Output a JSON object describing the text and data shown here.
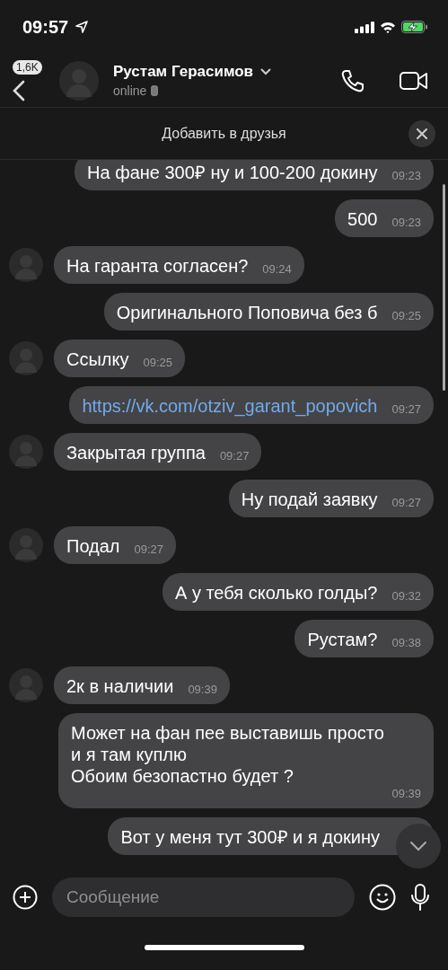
{
  "status_bar": {
    "time": "09:57"
  },
  "header": {
    "back_badge": "1,6K",
    "name": "Рустам Герасимов",
    "status": "online"
  },
  "banner": {
    "text": "Добавить в друзья"
  },
  "messages": [
    {
      "kind": "outgoing",
      "text": "На фане 300₽ ну и 100-200 докину",
      "time": "09:23",
      "link": false
    },
    {
      "kind": "outgoing",
      "text": "500",
      "time": "09:23",
      "link": false
    },
    {
      "kind": "incoming",
      "text": "На гаранта согласен?",
      "time": "09:24",
      "link": false
    },
    {
      "kind": "outgoing",
      "text": "Оригинального Поповича без б",
      "time": "09:25",
      "link": false
    },
    {
      "kind": "incoming",
      "text": "Ссылку",
      "time": "09:25",
      "link": false
    },
    {
      "kind": "outgoing",
      "text": "https://vk.com/otziv_garant_popovich",
      "time": "09:27",
      "link": true
    },
    {
      "kind": "incoming",
      "text": "Закрытая группа",
      "time": "09:27",
      "link": false
    },
    {
      "kind": "outgoing",
      "text": "Ну подай заявку",
      "time": "09:27",
      "link": false
    },
    {
      "kind": "incoming",
      "text": "Подал",
      "time": "09:27",
      "link": false
    },
    {
      "kind": "outgoing",
      "text": "А у тебя сколько голды?",
      "time": "09:32",
      "link": false
    },
    {
      "kind": "outgoing",
      "text": "Рустам?",
      "time": "09:38",
      "link": false
    },
    {
      "kind": "incoming",
      "text": "2к в наличии",
      "time": "09:39",
      "link": false
    },
    {
      "kind": "outgoing",
      "text": "Может на фан пее выставишь просто\nи я там куплю\nОбоим безопастно будет ?",
      "time": "09:39",
      "link": false
    },
    {
      "kind": "outgoing",
      "text": "Вот у меня тут 300₽ и я докину",
      "link": false
    }
  ],
  "composer": {
    "placeholder": "Сообщение"
  }
}
